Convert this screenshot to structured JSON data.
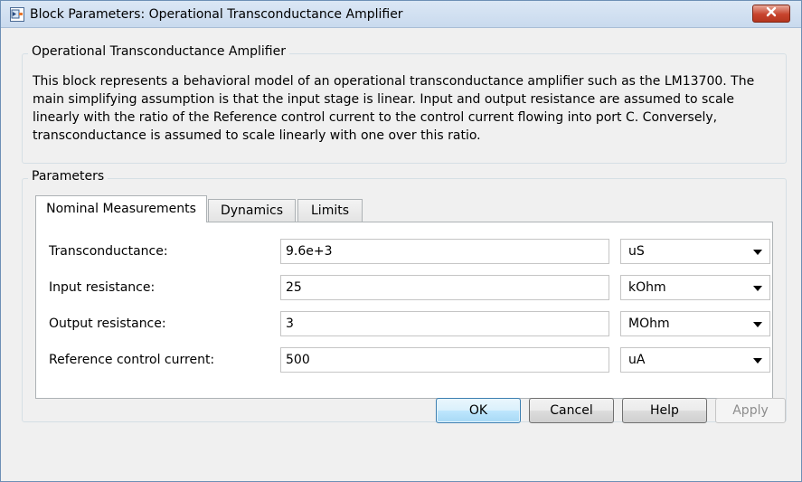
{
  "window": {
    "title": "Block Parameters: Operational Transconductance Amplifier",
    "close_icon": "close-icon"
  },
  "description": {
    "group_label": "Operational Transconductance Amplifier",
    "lines": [
      "This block represents a behavioral model of an operational transconductance amplifier such as the LM13700. The",
      "main simplifying assumption is that the input stage is linear. Input and output resistance are assumed to scale",
      "linearly with the ratio of the Reference control current to the control current flowing into port C. Conversely,",
      "transconductance is assumed to scale linearly with one over this ratio."
    ]
  },
  "parameters": {
    "group_label": "Parameters",
    "tabs": [
      {
        "label": "Nominal Measurements",
        "active": true
      },
      {
        "label": "Dynamics",
        "active": false
      },
      {
        "label": "Limits",
        "active": false
      }
    ],
    "rows": [
      {
        "label": "Transconductance:",
        "value": "9.6e+3",
        "unit": "uS"
      },
      {
        "label": "Input resistance:",
        "value": "25",
        "unit": "kOhm"
      },
      {
        "label": "Output resistance:",
        "value": "3",
        "unit": "MOhm"
      },
      {
        "label": "Reference control current:",
        "value": "500",
        "unit": "uA"
      }
    ]
  },
  "buttons": {
    "ok": "OK",
    "cancel": "Cancel",
    "help": "Help",
    "apply": "Apply"
  },
  "colors": {
    "titlebar": "#c9daee",
    "close_button": "#c7432d",
    "default_button_border": "#3c7fb1",
    "dialog_background": "#f0f0f0"
  }
}
